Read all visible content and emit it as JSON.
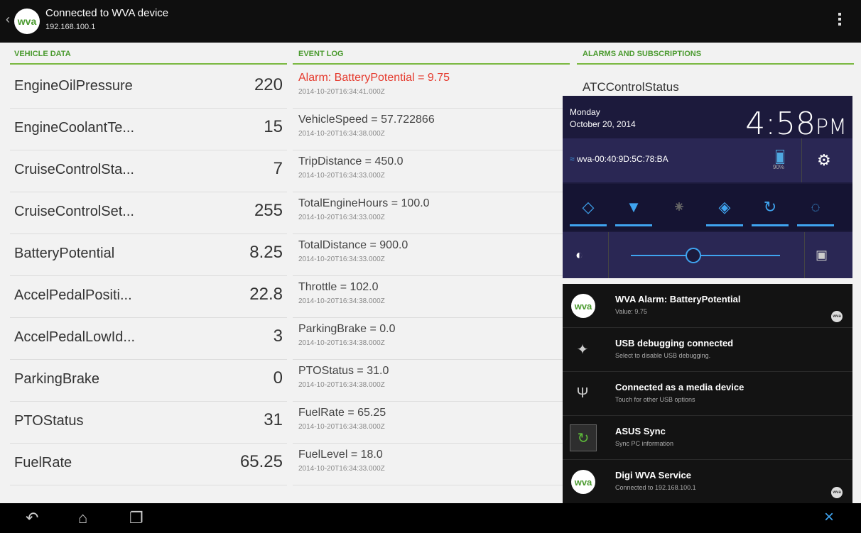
{
  "action_bar": {
    "back": "‹",
    "logo_text": "wva",
    "title": "Connected to WVA device",
    "subtitle": "192.168.100.1"
  },
  "vehicle_data": {
    "header": "VEHICLE DATA",
    "rows": [
      {
        "name": "EngineOilPressure",
        "value": "220"
      },
      {
        "name": "EngineCoolantTe...",
        "value": "15"
      },
      {
        "name": "CruiseControlSta...",
        "value": "7"
      },
      {
        "name": "CruiseControlSet...",
        "value": "255"
      },
      {
        "name": "BatteryPotential",
        "value": "8.25"
      },
      {
        "name": "AccelPedalPositi...",
        "value": "22.8"
      },
      {
        "name": "AccelPedalLowId...",
        "value": "3"
      },
      {
        "name": "ParkingBrake",
        "value": "0"
      },
      {
        "name": "PTOStatus",
        "value": "31"
      },
      {
        "name": "FuelRate",
        "value": "65.25"
      }
    ]
  },
  "event_log": {
    "header": "EVENT LOG",
    "rows": [
      {
        "text": "Alarm: BatteryPotential = 9.75",
        "time": "2014-10-20T16:34:41.000Z",
        "alarm": true
      },
      {
        "text": "VehicleSpeed = 57.722866",
        "time": "2014-10-20T16:34:38.000Z"
      },
      {
        "text": "TripDistance = 450.0",
        "time": "2014-10-20T16:34:33.000Z"
      },
      {
        "text": "TotalEngineHours = 100.0",
        "time": "2014-10-20T16:34:33.000Z"
      },
      {
        "text": "TotalDistance = 900.0",
        "time": "2014-10-20T16:34:33.000Z"
      },
      {
        "text": "Throttle = 102.0",
        "time": "2014-10-20T16:34:38.000Z"
      },
      {
        "text": "ParkingBrake = 0.0",
        "time": "2014-10-20T16:34:38.000Z"
      },
      {
        "text": "PTOStatus = 31.0",
        "time": "2014-10-20T16:34:38.000Z"
      },
      {
        "text": "FuelRate = 65.25",
        "time": "2014-10-20T16:34:38.000Z"
      },
      {
        "text": "FuelLevel = 18.0",
        "time": "2014-10-20T16:34:33.000Z"
      }
    ]
  },
  "alarms": {
    "header": "ALARMS AND SUBSCRIPTIONS",
    "first_item": "ATCControlStatus"
  },
  "quick_settings": {
    "day": "Monday",
    "date": "October 20, 2014",
    "time": "4:58",
    "ampm": "PM",
    "wifi_name": "wva-00:40:9D:5C:78:BA",
    "battery_pct": "90%",
    "battery_level": 0.9,
    "brightness_level": 0.42
  },
  "notifications": [
    {
      "icon": "wva-logo-icon",
      "title": "WVA Alarm: BatteryPotential",
      "subtitle": "Value: 9.75",
      "badge": "wva"
    },
    {
      "icon": "android-icon",
      "title": "USB debugging connected",
      "subtitle": "Select to disable USB debugging."
    },
    {
      "icon": "usb-icon",
      "title": "Connected as a media device",
      "subtitle": "Touch for other USB options"
    },
    {
      "icon": "asus-sync-icon",
      "title": "ASUS Sync",
      "subtitle": "Sync PC information"
    },
    {
      "icon": "wva-logo-icon",
      "title": "Digi WVA Service",
      "subtitle": "Connected to 192.168.100.1",
      "badge": "wva"
    }
  ],
  "colors": {
    "accent_green": "#4a9a2e",
    "alarm_red": "#e53a2e",
    "android_blue": "#3fa4f0"
  }
}
